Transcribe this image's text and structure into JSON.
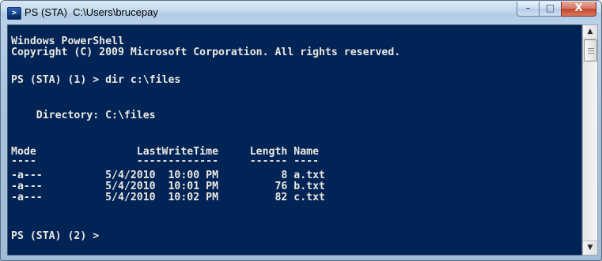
{
  "window": {
    "title": "PS (STA)  C:\\Users\\brucepay",
    "app_icon": "powershell-icon",
    "icon_glyph": ">",
    "caption_buttons": {
      "minimize": "–",
      "maximize": "□",
      "close": "X"
    }
  },
  "console": {
    "background": "#012456",
    "foreground": "#ece8e0",
    "banner": [
      "Windows PowerShell",
      "Copyright (C) 2009 Microsoft Corporation. All rights reserved."
    ],
    "command_1": "PS (STA) (1) > dir c:\\files",
    "directory_line": "    Directory: C:\\files",
    "table": {
      "header": "Mode                LastWriteTime     Length Name",
      "underline": "----                -------------     ------ ----",
      "rows": [
        "-a---          5/4/2010  10:00 PM          8 a.txt",
        "-a---          5/4/2010  10:01 PM         76 b.txt",
        "-a---          5/4/2010  10:02 PM         82 c.txt"
      ]
    },
    "prompt_2": "PS (STA) (2) > "
  },
  "scrollbar": {
    "up_arrow": "▲",
    "down_arrow": "▼"
  }
}
